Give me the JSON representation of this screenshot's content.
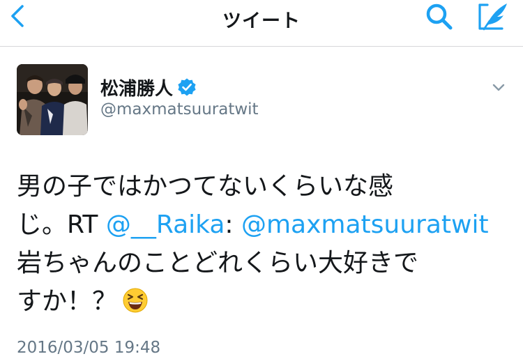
{
  "navbar": {
    "title": "ツイート",
    "back_icon": "chevron-left-icon",
    "search_icon": "search-icon",
    "compose_icon": "compose-icon",
    "accent_color": "#1da1f2"
  },
  "tweet": {
    "author": {
      "display_name": "松浦勝人",
      "handle": "@maxmatsuuratwit",
      "verified": true
    },
    "text": {
      "line1": "男の子ではかつてないくらいな感",
      "line2_prefix": "じ。RT ",
      "mention1": "@__Raika",
      "colon": ": ",
      "mention2": "@maxmatsuuratwit",
      "line3": "岩ちゃんのことどれくらい大好きで",
      "line4": "すか！？",
      "emoji": "laughing-face-emoji"
    },
    "timestamp": "2016/03/05 19:48"
  }
}
